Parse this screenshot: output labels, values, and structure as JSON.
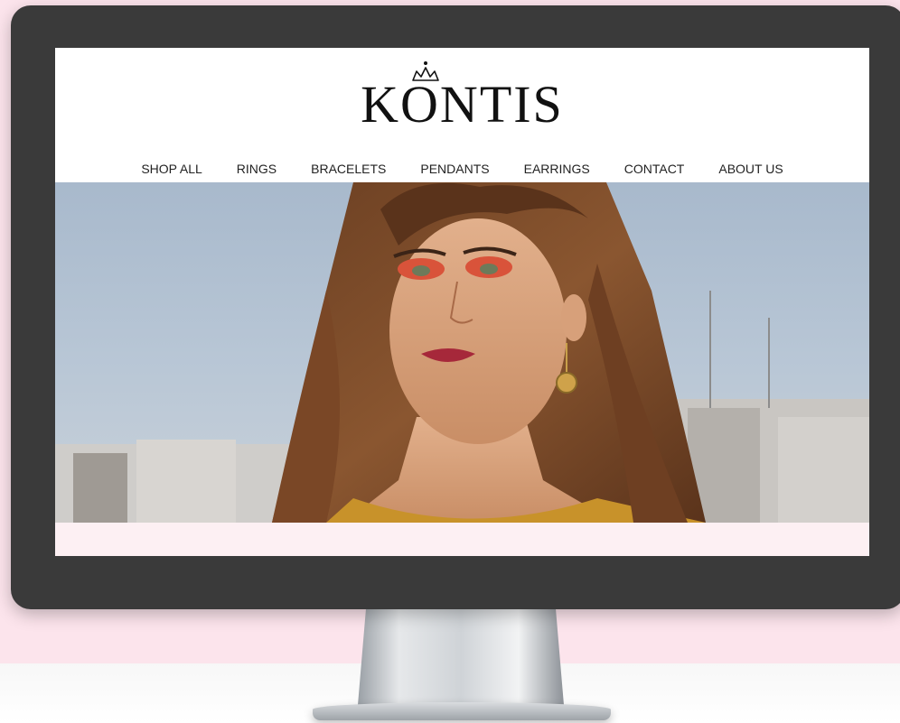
{
  "site": {
    "logo_text": "KONTIS"
  },
  "nav": {
    "items": [
      {
        "label": "SHOP ALL"
      },
      {
        "label": "RINGS"
      },
      {
        "label": "BRACELETS"
      },
      {
        "label": "PENDANTS"
      },
      {
        "label": "EARRINGS"
      },
      {
        "label": "CONTACT"
      },
      {
        "label": "ABOUT US"
      }
    ]
  },
  "hero": {
    "image_alt": "Woman wearing gold earring"
  },
  "colors": {
    "backdrop": "#fce4ec",
    "monitor_bezel": "#3a3a3a",
    "footer_strip": "#fdf0f3"
  }
}
